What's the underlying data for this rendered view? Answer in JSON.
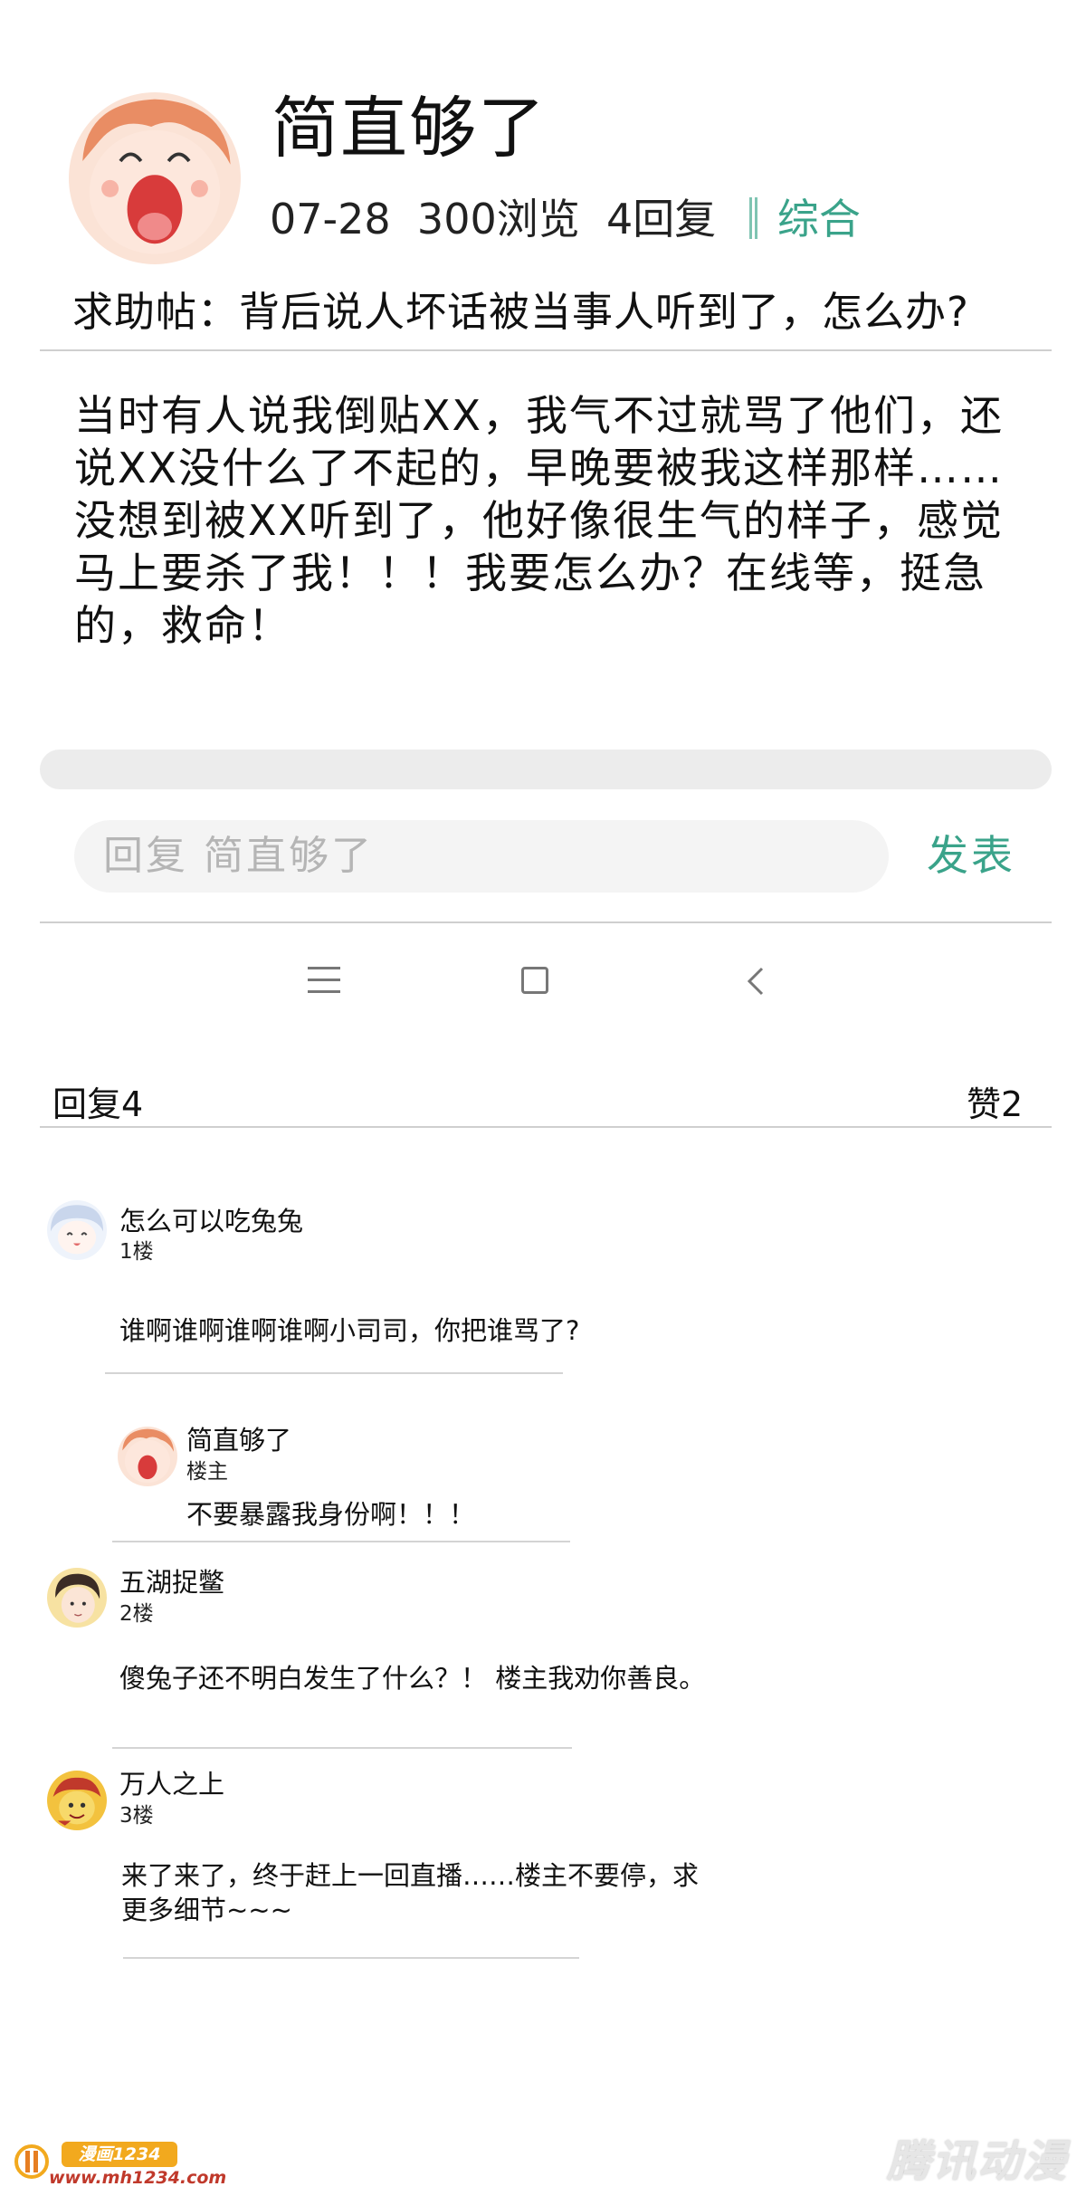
{
  "post": {
    "author": "简直够了",
    "date": "07-28",
    "views": "300浏览",
    "replies": "4回复",
    "category": "综合",
    "subject": "求助帖：背后说人坏话被当事人听到了，怎么办?",
    "body": "当时有人说我倒贴XX，我气不过就骂了他们，还说XX没什么了不起的，早晚要被我这样那样……没想到被XX听到了，他好像很生气的样子，感觉马上要杀了我！！！我要怎么办？在线等，挺急的，救命！"
  },
  "reply_bar": {
    "placeholder": "回复  简直够了",
    "send_label": "发表"
  },
  "nav_bar": {
    "icons": [
      "menu-icon",
      "home-icon",
      "back-icon"
    ]
  },
  "replies_header": {
    "count_label": "回复4",
    "likes_label": "赞2"
  },
  "comments": [
    {
      "name": "怎么可以吃兔兔",
      "floor": "1楼",
      "text": "谁啊谁啊谁啊谁啊小司司，你把谁骂了?"
    },
    {
      "name": "简直够了",
      "floor": "楼主",
      "text": "不要暴露我身份啊！！！",
      "is_sub_reply": true
    },
    {
      "name": "五湖捉鳖",
      "floor": "2楼",
      "text": "傻兔子还不明白发生了什么？！ 楼主我劝你善良。"
    },
    {
      "name": "万人之上",
      "floor": "3楼",
      "text_line1": "来了来了，终于赶上一回直播……楼主不要停，求",
      "text_line2": "更多细节~~~"
    }
  ],
  "watermarks": {
    "left_badge": "漫画1234",
    "left_url": "www.mh1234.com",
    "right": "腾讯动漫"
  },
  "colors": {
    "accent": "#3aa38a",
    "divider": "#cfcfcf",
    "placeholder": "#b5b5b5"
  }
}
